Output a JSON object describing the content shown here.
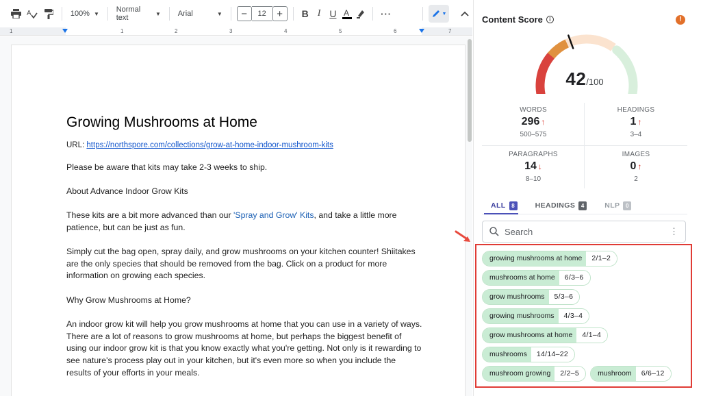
{
  "toolbar": {
    "zoom": "100%",
    "style": "Normal text",
    "font": "Arial",
    "font_size": "12",
    "minus": "−",
    "plus": "+",
    "more": "···",
    "colors": {
      "text_underline": "#000000",
      "edit_accent": "#1a73e8"
    }
  },
  "ruler": {
    "numbers": [
      "1",
      "1",
      "2",
      "3",
      "4",
      "5",
      "6",
      "7"
    ]
  },
  "document": {
    "title": "Growing Mushrooms at Home",
    "url_label": "URL: ",
    "url": "https://northspore.com/collections/grow-at-home-indoor-mushroom-kits",
    "p1": "Please be aware that kits may take 2-3 weeks to ship.",
    "p2": "About Advance Indoor Grow Kits",
    "p3_a": "These kits are a bit more advanced than our ",
    "p3_link": "'Spray and Grow' Kits",
    "p3_b": ", and take a little more patience, but can be just as fun.",
    "p4": "Simply cut the bag open, spray daily, and grow mushrooms on your kitchen counter! Shiitakes are the only species that should be removed from the bag. Click on a product for more information on growing each species.",
    "p5": "Why Grow Mushrooms at Home?",
    "p6": "An indoor grow kit will help you grow mushrooms at home that you can use in a variety of ways. There are a lot of reasons to grow mushrooms at home, but perhaps the biggest benefit of using our indoor grow kit is that you know exactly what you're getting. Not only is it rewarding to see nature's process play out in your kitchen, but it's even more so when you include the results of your efforts in your meals."
  },
  "panel": {
    "title": "Content Score",
    "info_icon": "ⓘ",
    "alert_icon": "!",
    "score": {
      "value": "42",
      "max": "/100",
      "fraction": 0.42
    },
    "gauge_colors": {
      "red": "#d9423d",
      "orange": "#e0913f",
      "peach": "#fbe3cf",
      "green": "#d8efdc"
    },
    "stats": [
      {
        "label": "WORDS",
        "value": "296",
        "arrow": "↑",
        "range": "500–575"
      },
      {
        "label": "HEADINGS",
        "value": "1",
        "arrow": "↑",
        "range": "3–4"
      },
      {
        "label": "PARAGRAPHS",
        "value": "14",
        "arrow": "↓",
        "range": "8–10"
      },
      {
        "label": "IMAGES",
        "value": "0",
        "arrow": "↑",
        "range": "2"
      }
    ],
    "tabs": [
      {
        "label": "ALL",
        "count": "8"
      },
      {
        "label": "HEADINGS",
        "count": "4"
      },
      {
        "label": "NLP",
        "count": "0"
      }
    ],
    "search": {
      "placeholder": "Search"
    },
    "keywords": [
      {
        "term": "growing mushrooms at home",
        "count": "2/1–2"
      },
      {
        "term": "mushrooms at home",
        "count": "6/3–6"
      },
      {
        "term": "grow mushrooms",
        "count": "5/3–6"
      },
      {
        "term": "growing mushrooms",
        "count": "4/3–4"
      },
      {
        "term": "grow mushrooms at home",
        "count": "4/1–4"
      },
      {
        "term": "mushrooms",
        "count": "14/14–22"
      },
      {
        "term": "mushroom growing",
        "count": "2/2–5"
      },
      {
        "term": "mushroom",
        "count": "6/6–12"
      }
    ],
    "highlight_color": "#e03b35"
  }
}
